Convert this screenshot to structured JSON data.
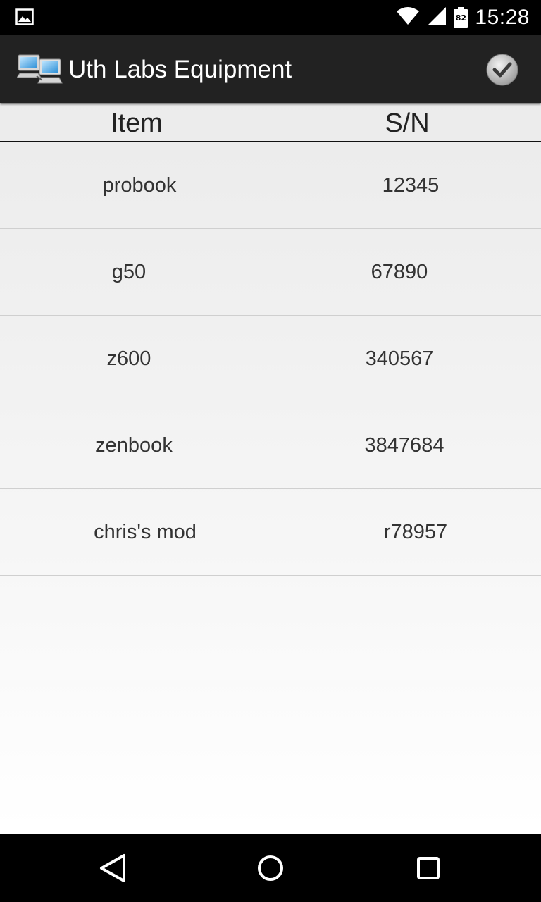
{
  "status_bar": {
    "time": "15:28",
    "battery_level": "82",
    "icons": [
      "image-notification-icon",
      "wifi-icon",
      "cell-signal-icon",
      "battery-icon"
    ]
  },
  "action_bar": {
    "title": "Uth Labs Equipment",
    "logo_icon": "networked-computers-icon",
    "action_icon": "checkmark-icon"
  },
  "table": {
    "headers": {
      "item": "Item",
      "sn": "S/N"
    },
    "rows": [
      {
        "item": "probook",
        "sn": "12345"
      },
      {
        "item": "g50",
        "sn": "67890"
      },
      {
        "item": "z600",
        "sn": "340567"
      },
      {
        "item": "zenbook",
        "sn": "3847684"
      },
      {
        "item": "chris's mod",
        "sn": "r78957"
      }
    ]
  },
  "nav_bar": {
    "icons": [
      "back-icon",
      "home-icon",
      "recents-icon"
    ]
  },
  "colors": {
    "status_bar_bg": "#000000",
    "action_bar_bg": "#222222",
    "text": "#333333"
  }
}
